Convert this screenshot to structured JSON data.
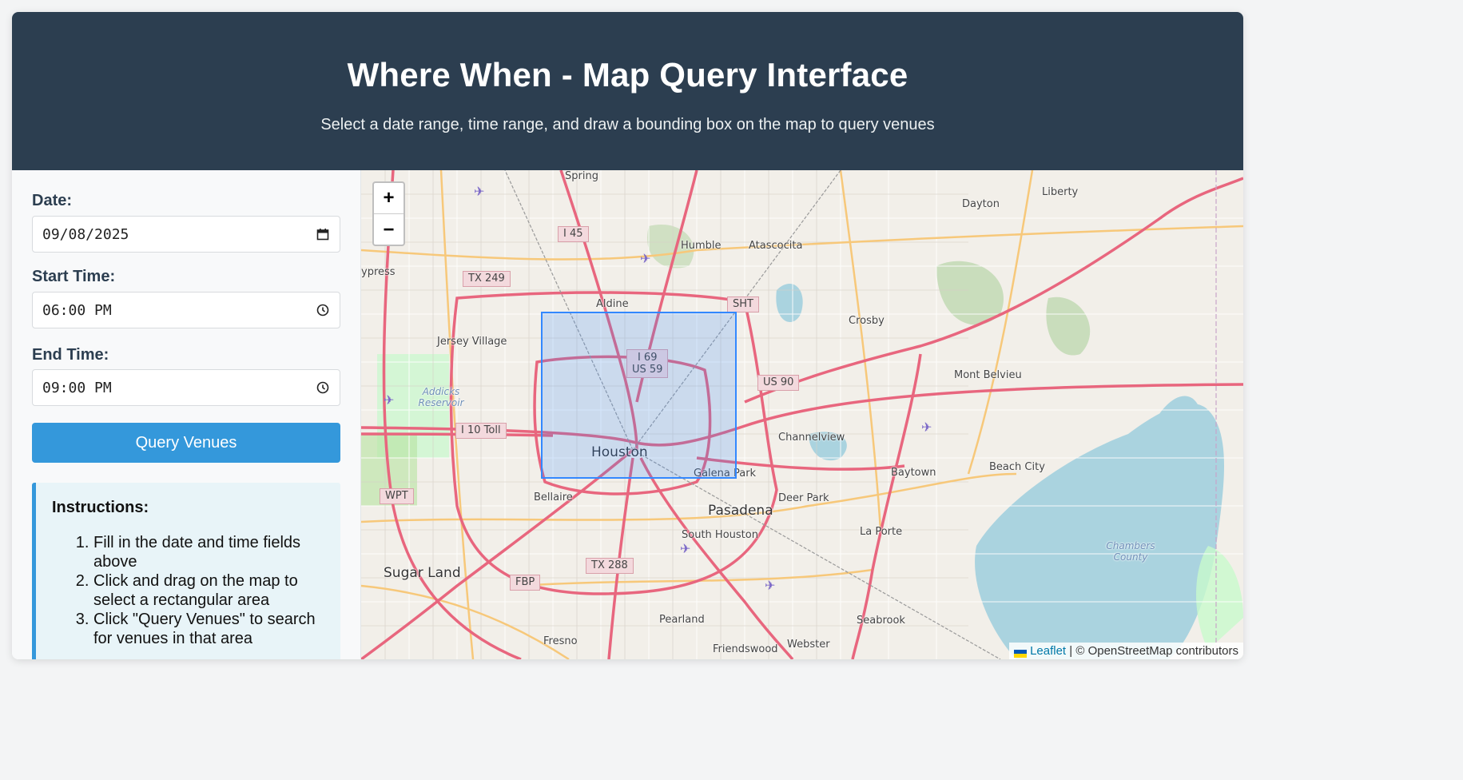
{
  "header": {
    "title": "Where When - Map Query Interface",
    "subtitle": "Select a date range, time range, and draw a bounding box on the map to query venues"
  },
  "form": {
    "date_label": "Date:",
    "date_value": "09/08/2025",
    "start_label": "Start Time:",
    "start_value": "06:00 PM",
    "end_label": "End Time:",
    "end_value": "09:00 PM",
    "query_button": "Query Venues"
  },
  "instructions": {
    "title": "Instructions:",
    "steps": [
      "Fill in the date and time fields above",
      "Click and drag on the map to select a rectangular area",
      "Click \"Query Venues\" to search for venues in that area"
    ]
  },
  "map": {
    "zoom_in": "+",
    "zoom_out": "−",
    "attribution_link": "Leaflet",
    "attribution_text": "| © OpenStreetMap contributors",
    "road_shields": [
      "I 45",
      "TX 249",
      "SHT",
      "I 69",
      "US 59",
      "US 90",
      "I 10 Toll",
      "WPT",
      "TX 288",
      "FBP"
    ],
    "places": [
      "Spring",
      "Humble",
      "Atascocita",
      "Dayton",
      "Liberty",
      "ypress",
      "Aldine",
      "Crosby",
      "Jersey Village",
      "Mont Belvieu",
      "Addicks Reservoir",
      "Channelview",
      "Houston",
      "Galena Park",
      "Baytown",
      "Beach City",
      "Bellaire",
      "Deer Park",
      "Pasadena",
      "South Houston",
      "La Porte",
      "Chambers County",
      "Sugar Land",
      "Pearland",
      "Seabrook",
      "Fresno",
      "Friendswood",
      "Webster"
    ]
  },
  "colors": {
    "header_bg": "#2c3e50",
    "accent": "#3498db",
    "bbox": "#3388ff"
  }
}
